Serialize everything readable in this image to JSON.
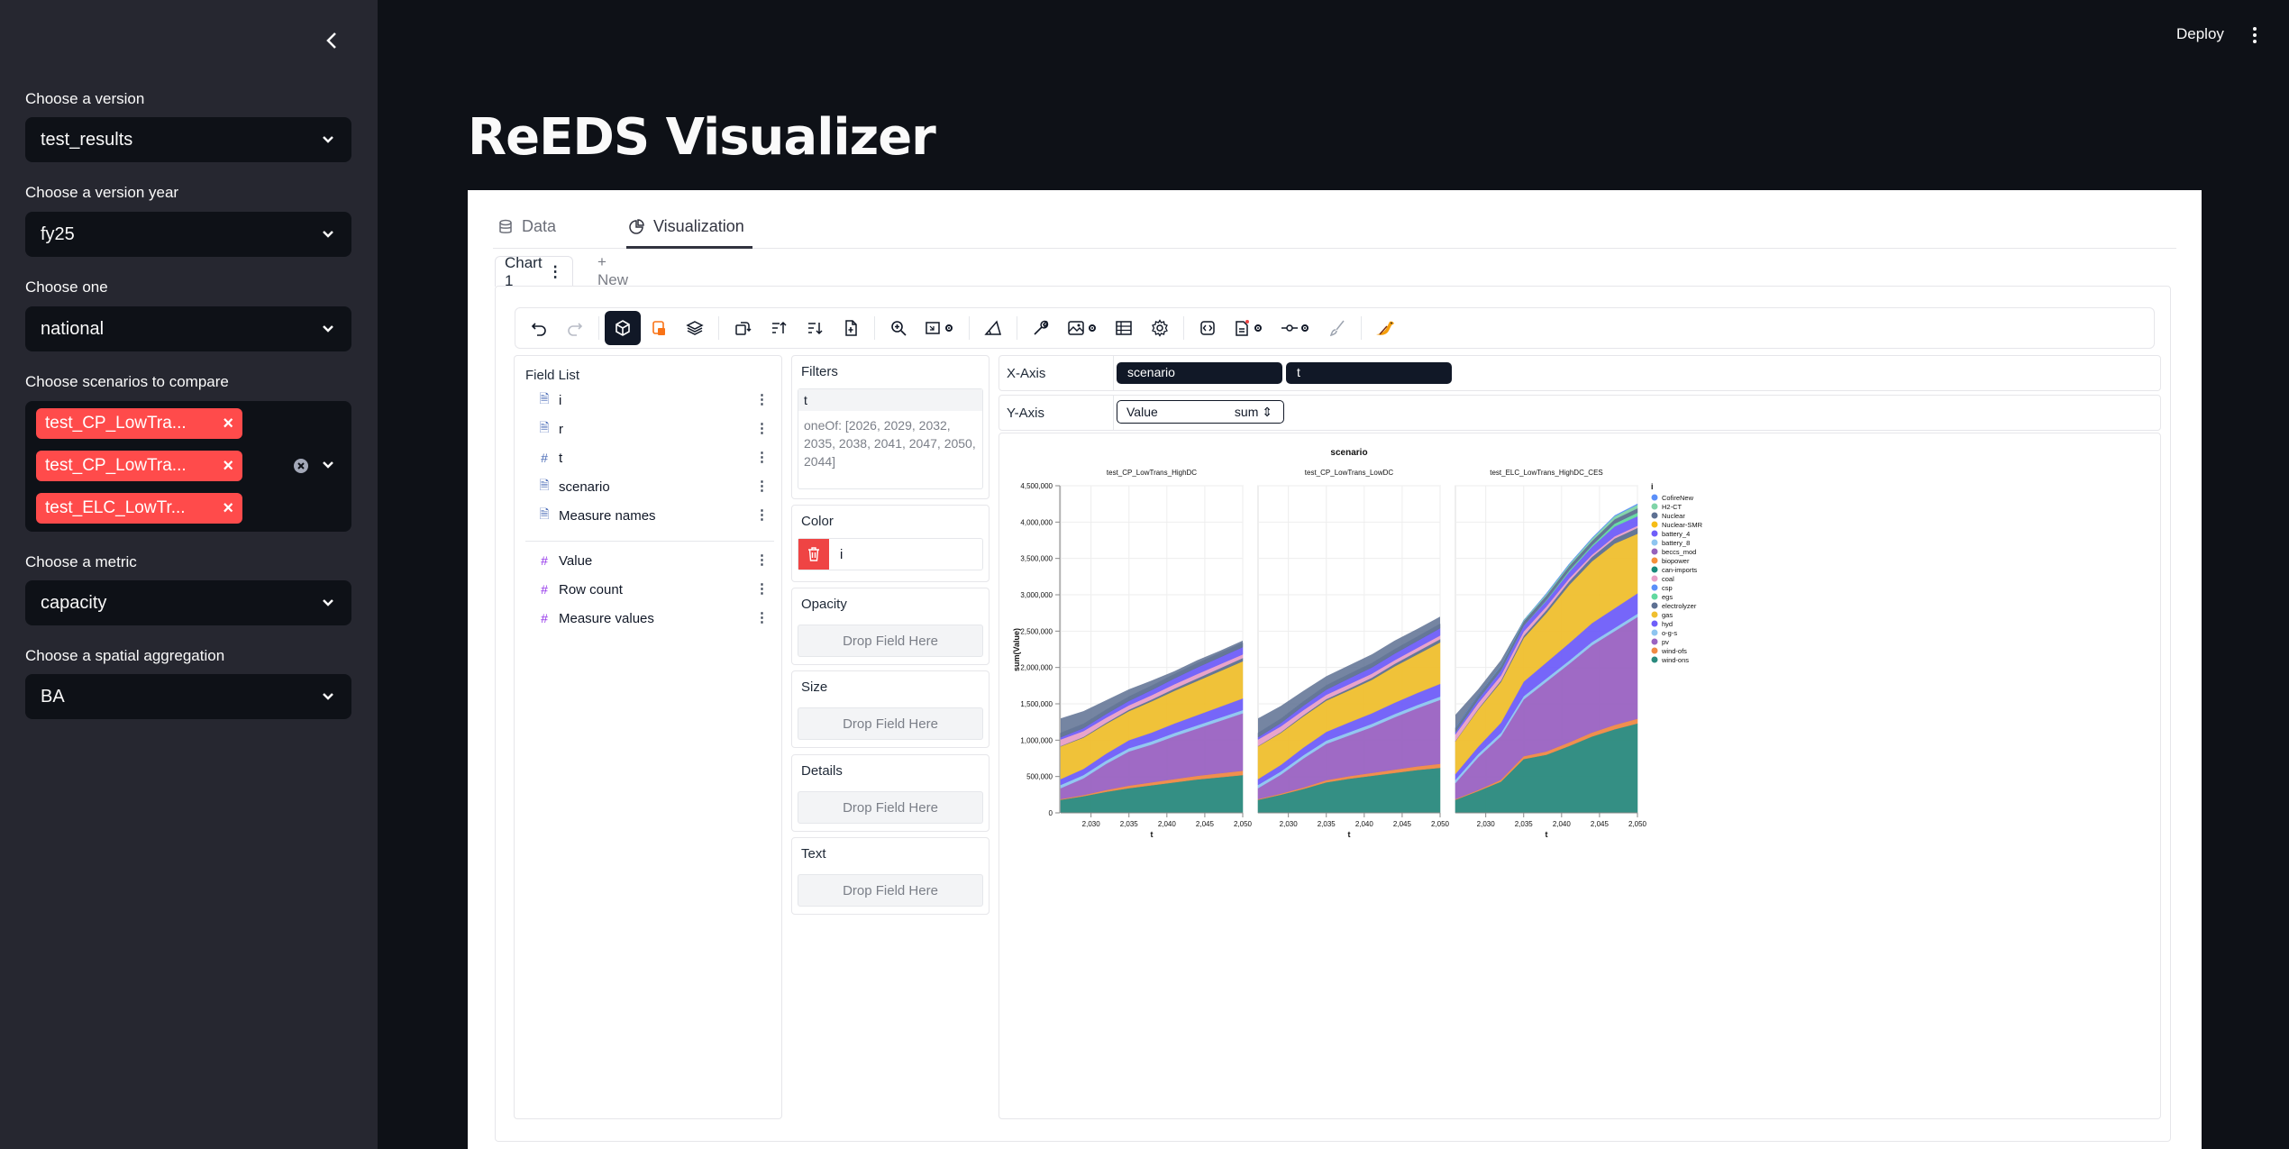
{
  "sidebar": {
    "version_label": "Choose a version",
    "version_value": "test_results",
    "year_label": "Choose a version year",
    "year_value": "fy25",
    "one_label": "Choose one",
    "one_value": "national",
    "scenarios_label": "Choose scenarios to compare",
    "scenarios": [
      "test_CP_LowTrans_HighDC",
      "test_CP_LowTrans_LowDC",
      "test_ELC_LowTrans_HighDC_CES"
    ],
    "scenario_chips": [
      "test_CP_LowTra...",
      "test_CP_LowTra...",
      "test_ELC_LowTr..."
    ],
    "metric_label": "Choose a metric",
    "metric_value": "capacity",
    "agg_label": "Choose a spatial aggregation",
    "agg_value": "BA"
  },
  "header": {
    "deploy_label": "Deploy"
  },
  "page_title": "ReEDS Visualizer",
  "tabs": [
    {
      "label": "Data"
    },
    {
      "label": "Visualization"
    }
  ],
  "chart_tabs": {
    "active": "Chart 1",
    "new": "+ New"
  },
  "field_list": {
    "title": "Field List",
    "dimensions": [
      {
        "name": "i",
        "icon": "doc-icon"
      },
      {
        "name": "r",
        "icon": "doc-icon"
      },
      {
        "name": "t",
        "icon": "hash-icon"
      },
      {
        "name": "scenario",
        "icon": "doc-icon"
      },
      {
        "name": "Measure names",
        "icon": "doc-icon"
      }
    ],
    "measures": [
      {
        "name": "Value",
        "icon": "hash-icon"
      },
      {
        "name": "Row count",
        "icon": "hash-icon"
      },
      {
        "name": "Measure values",
        "icon": "hash-icon"
      }
    ]
  },
  "encodings": {
    "filters_title": "Filters",
    "filter_field": "t",
    "filter_value": "oneOf: [2026, 2029, 2032, 2035, 2038, 2041, 2047, 2050, 2044]",
    "color_title": "Color",
    "color_field": "i",
    "opacity_title": "Opacity",
    "size_title": "Size",
    "details_title": "Details",
    "text_title": "Text",
    "drop_text": "Drop Field Here"
  },
  "axes": {
    "x_label": "X-Axis",
    "x_fields": [
      "scenario",
      "t"
    ],
    "y_label": "Y-Axis",
    "y_field": "Value",
    "y_agg": "sum ⇕"
  },
  "chart_data": {
    "type": "area",
    "stacked": true,
    "title": "scenario",
    "xlabel": "t",
    "ylabel": "sum(Value)",
    "ylim": [
      0,
      4500000
    ],
    "y_ticks": [
      "0",
      "500,000",
      "1,000,000",
      "1,500,000",
      "2,000,000",
      "2,500,000",
      "3,000,000",
      "3,500,000",
      "4,000,000",
      "4,500,000"
    ],
    "x_ticks": [
      "2,030",
      "2,035",
      "2,040",
      "2,045",
      "2,050"
    ],
    "x": [
      2026,
      2029,
      2032,
      2035,
      2038,
      2041,
      2044,
      2047,
      2050
    ],
    "legend_title": "i",
    "legend_position": "right",
    "legend": [
      {
        "name": "CofireNew",
        "color": "#5b8ff9"
      },
      {
        "name": "H2-CT",
        "color": "#7fd4a8"
      },
      {
        "name": "Nuclear",
        "color": "#5d7092"
      },
      {
        "name": "Nuclear-SMR",
        "color": "#f6bd16"
      },
      {
        "name": "battery_4",
        "color": "#6f5ef9"
      },
      {
        "name": "battery_8",
        "color": "#8ec5f0"
      },
      {
        "name": "beccs_mod",
        "color": "#9661bc"
      },
      {
        "name": "biopower",
        "color": "#f6903d"
      },
      {
        "name": "can-imports",
        "color": "#1a8a7c"
      },
      {
        "name": "coal",
        "color": "#e8a0c8"
      },
      {
        "name": "csp",
        "color": "#5b8ff9"
      },
      {
        "name": "egs",
        "color": "#61d9a0"
      },
      {
        "name": "electrolyzer",
        "color": "#5d7092"
      },
      {
        "name": "gas",
        "color": "#f0bf2f"
      },
      {
        "name": "hyd",
        "color": "#6f5ef9"
      },
      {
        "name": "o-g-s",
        "color": "#8ec5f0"
      },
      {
        "name": "pv",
        "color": "#9a63c2"
      },
      {
        "name": "wind-ofs",
        "color": "#f08a45"
      },
      {
        "name": "wind-ons",
        "color": "#2a8a7e"
      }
    ],
    "facets": [
      {
        "name": "test_CP_LowTrans_HighDC",
        "totals": [
          1300000,
          1400000,
          1550000,
          1700000,
          1820000,
          1950000,
          2100000,
          2230000,
          2370000
        ],
        "series": [
          {
            "name": "wind-ons",
            "values": [
              180000,
              230000,
              290000,
              340000,
              380000,
              420000,
              460000,
              490000,
              520000
            ]
          },
          {
            "name": "wind-ofs",
            "values": [
              10000,
              15000,
              25000,
              35000,
              40000,
              45000,
              50000,
              55000,
              60000
            ]
          },
          {
            "name": "pv",
            "values": [
              150000,
              230000,
              360000,
              470000,
              520000,
              590000,
              650000,
              720000,
              790000
            ]
          },
          {
            "name": "o-g-s",
            "values": [
              45000,
              45000,
              45000,
              45000,
              45000,
              45000,
              45000,
              45000,
              45000
            ]
          },
          {
            "name": "hyd",
            "values": [
              80000,
              85000,
              95000,
              110000,
              120000,
              130000,
              140000,
              150000,
              160000
            ]
          },
          {
            "name": "gas",
            "values": [
              450000,
              430000,
              410000,
              400000,
              430000,
              450000,
              470000,
              490000,
              510000
            ]
          },
          {
            "name": "electrolyzer",
            "values": [
              5000,
              10000,
              15000,
              20000,
              25000,
              30000,
              35000,
              40000,
              45000
            ]
          },
          {
            "name": "coal",
            "values": [
              90000,
              80000,
              70000,
              60000,
              60000,
              60000,
              60000,
              55000,
              50000
            ]
          },
          {
            "name": "battery_4",
            "values": [
              30000,
              40000,
              50000,
              60000,
              70000,
              80000,
              90000,
              95000,
              100000
            ]
          },
          {
            "name": "Nuclear",
            "values": [
              60000,
              60000,
              60000,
              60000,
              60000,
              60000,
              60000,
              60000,
              60000
            ]
          }
        ]
      },
      {
        "name": "test_CP_LowTrans_LowDC",
        "totals": [
          1300000,
          1470000,
          1680000,
          1880000,
          2030000,
          2180000,
          2370000,
          2530000,
          2700000
        ],
        "series": [
          {
            "name": "wind-ons",
            "values": [
              180000,
              250000,
              330000,
              420000,
              470000,
              510000,
              550000,
              590000,
              620000
            ]
          },
          {
            "name": "wind-ofs",
            "values": [
              10000,
              15000,
              20000,
              30000,
              35000,
              40000,
              45000,
              50000,
              55000
            ]
          },
          {
            "name": "pv",
            "values": [
              150000,
              260000,
              400000,
              500000,
              560000,
              630000,
              720000,
              800000,
              880000
            ]
          },
          {
            "name": "o-g-s",
            "values": [
              45000,
              45000,
              45000,
              45000,
              45000,
              45000,
              45000,
              45000,
              45000
            ]
          },
          {
            "name": "hyd",
            "values": [
              80000,
              90000,
              105000,
              120000,
              135000,
              145000,
              155000,
              165000,
              175000
            ]
          },
          {
            "name": "gas",
            "values": [
              450000,
              440000,
              430000,
              430000,
              440000,
              460000,
              500000,
              530000,
              570000
            ]
          },
          {
            "name": "electrolyzer",
            "values": [
              5000,
              10000,
              15000,
              20000,
              25000,
              30000,
              35000,
              40000,
              45000
            ]
          },
          {
            "name": "coal",
            "values": [
              90000,
              80000,
              70000,
              60000,
              60000,
              55000,
              50000,
              50000,
              50000
            ]
          },
          {
            "name": "battery_4",
            "values": [
              30000,
              45000,
              60000,
              70000,
              80000,
              85000,
              90000,
              95000,
              100000
            ]
          },
          {
            "name": "Nuclear",
            "values": [
              60000,
              60000,
              60000,
              60000,
              60000,
              60000,
              60000,
              60000,
              60000
            ]
          }
        ]
      },
      {
        "name": "test_ELC_LowTrans_HighDC_CES",
        "totals": [
          1350000,
          1700000,
          2100000,
          2600000,
          2950000,
          3350000,
          3700000,
          4000000,
          4150000
        ],
        "series": [
          {
            "name": "wind-ons",
            "values": [
              180000,
              300000,
              430000,
              740000,
              800000,
              920000,
              1050000,
              1150000,
              1230000
            ]
          },
          {
            "name": "wind-ofs",
            "values": [
              10000,
              15000,
              25000,
              40000,
              45000,
              50000,
              55000,
              60000,
              65000
            ]
          },
          {
            "name": "pv",
            "values": [
              220000,
              450000,
              600000,
              780000,
              960000,
              1080000,
              1200000,
              1290000,
              1400000
            ]
          },
          {
            "name": "o-g-s",
            "values": [
              45000,
              45000,
              45000,
              45000,
              45000,
              45000,
              45000,
              45000,
              45000
            ]
          },
          {
            "name": "hyd",
            "values": [
              80000,
              100000,
              140000,
              200000,
              220000,
              240000,
              260000,
              270000,
              280000
            ]
          },
          {
            "name": "gas",
            "values": [
              450000,
              510000,
              560000,
              600000,
              680000,
              800000,
              850000,
              890000,
              820000
            ]
          },
          {
            "name": "electrolyzer",
            "values": [
              5000,
              10000,
              20000,
              30000,
              40000,
              50000,
              60000,
              70000,
              80000
            ]
          },
          {
            "name": "coal",
            "values": [
              90000,
              80000,
              70000,
              60000,
              50000,
              40000,
              30000,
              30000,
              30000
            ]
          },
          {
            "name": "battery_4",
            "values": [
              30000,
              50000,
              70000,
              80000,
              80000,
              90000,
              110000,
              135000,
              130000
            ]
          },
          {
            "name": "egs",
            "values": [
              0,
              0,
              0,
              0,
              10000,
              20000,
              20000,
              40000,
              50000
            ]
          },
          {
            "name": "Nuclear",
            "values": [
              60000,
              60000,
              60000,
              60000,
              60000,
              60000,
              60000,
              60000,
              60000
            ]
          },
          {
            "name": "H2-CT",
            "values": [
              0,
              0,
              5000,
              15000,
              20000,
              20000,
              30000,
              40000,
              50000
            ]
          },
          {
            "name": "CofireNew",
            "values": [
              0,
              0,
              0,
              0,
              10000,
              10000,
              10000,
              10000,
              10000
            ]
          }
        ]
      }
    ]
  }
}
